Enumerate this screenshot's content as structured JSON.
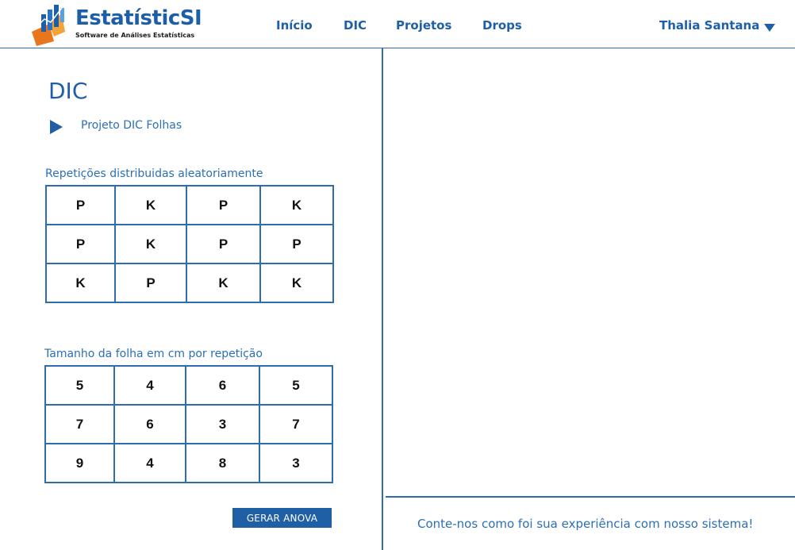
{
  "brand": {
    "name": "EstatísticSI",
    "tagline": "Software de Análises Estatísticas"
  },
  "nav": {
    "items": [
      "Início",
      "DIC",
      "Projetos",
      "Drops"
    ],
    "user_name": "Thalia Santana"
  },
  "page": {
    "title": "DIC",
    "project_name": "Projeto DIC Folhas"
  },
  "randomized": {
    "label": "Repetições distribuidas aleatoriamente",
    "rows": [
      [
        "P",
        "K",
        "P",
        "K"
      ],
      [
        "P",
        "K",
        "P",
        "P"
      ],
      [
        "K",
        "P",
        "K",
        "K"
      ]
    ]
  },
  "leaf_size": {
    "label": "Tamanho da folha em cm por repetição",
    "rows": [
      [
        "5",
        "4",
        "6",
        "5"
      ],
      [
        "7",
        "6",
        "3",
        "7"
      ],
      [
        "9",
        "4",
        "8",
        "3"
      ]
    ]
  },
  "actions": {
    "generate_label": "GERAR ANOVA"
  },
  "feedback": {
    "text": "Conte-nos como foi sua experiência com nosso sistema!"
  },
  "colors": {
    "primary": "#1f5fa6",
    "border": "#2d6cb0",
    "logo_orange": "#e8761c"
  }
}
